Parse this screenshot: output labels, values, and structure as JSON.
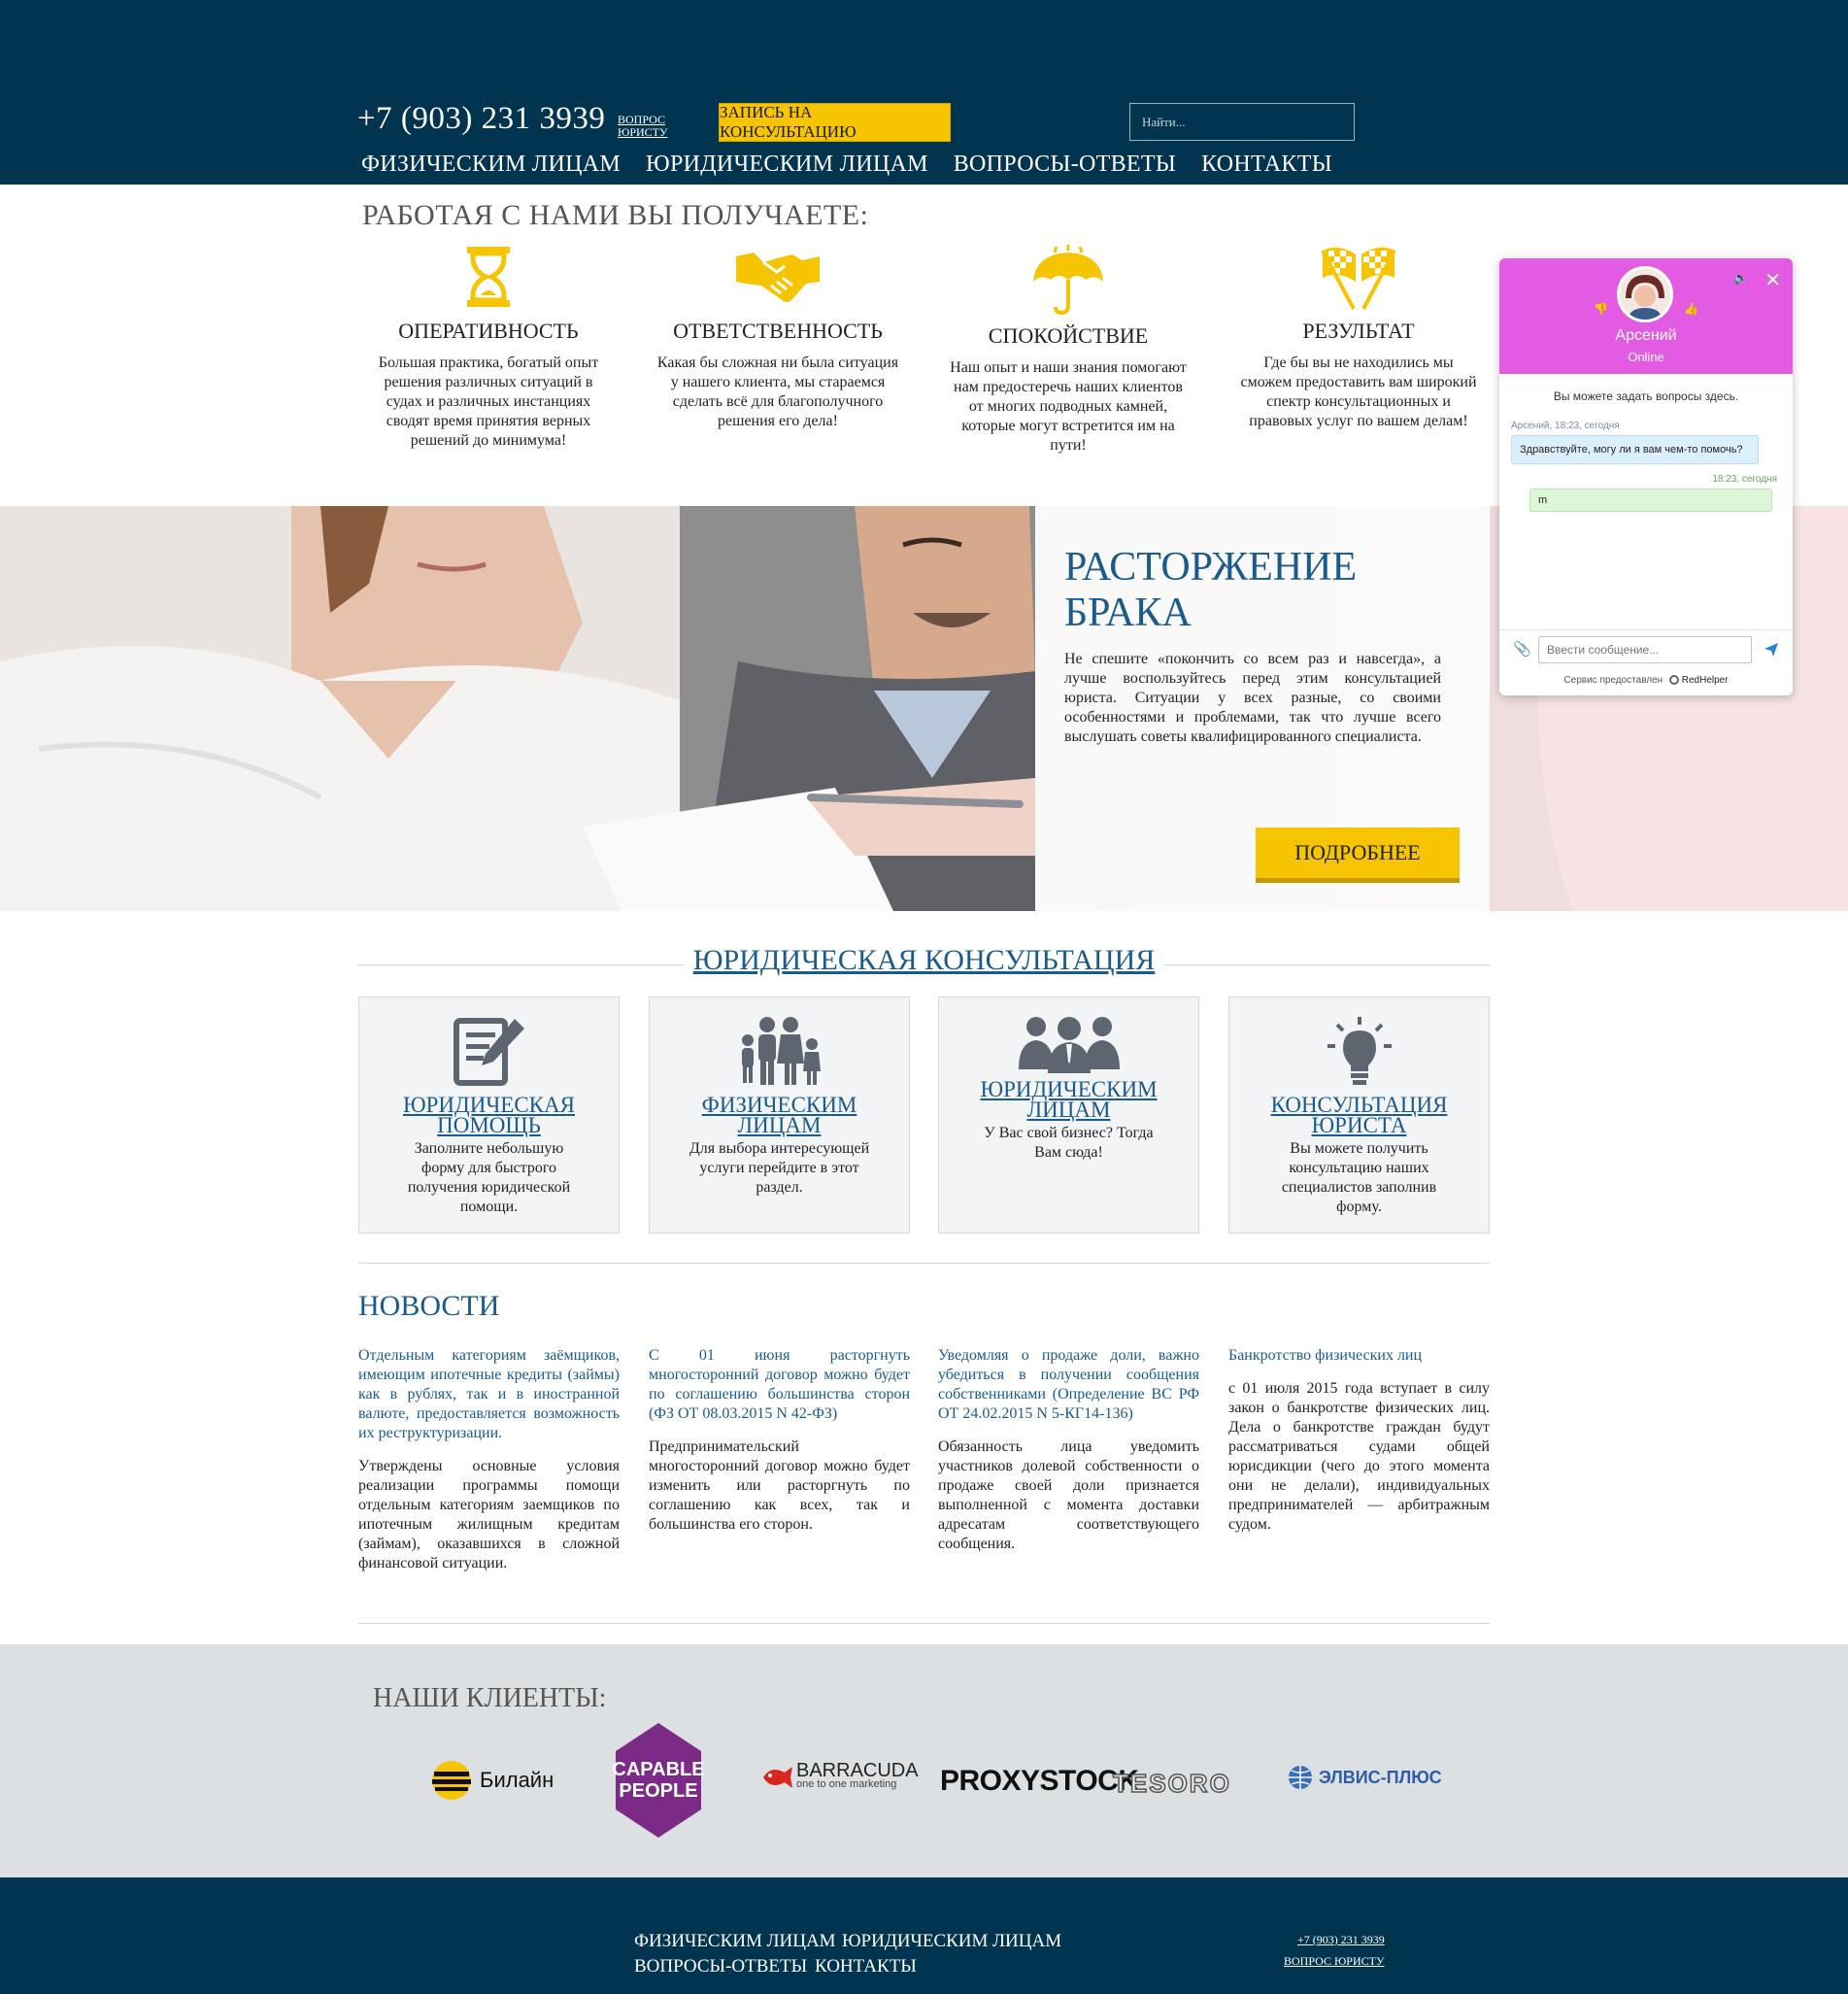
{
  "header": {
    "phone": "+7 (903) 231 3939",
    "ask_lawyer_line1": "ВОПРОС",
    "ask_lawyer_line2": "ЮРИСТУ",
    "consult_button": "ЗАПИСЬ НА КОНСУЛЬТАЦИЮ",
    "search_placeholder": "Найти...",
    "nav": [
      "ФИЗИЧЕСКИМ ЛИЦАМ",
      "ЮРИДИЧЕСКИМ ЛИЦАМ",
      "ВОПРОСЫ-ОТВЕТЫ",
      "КОНТАКТЫ"
    ]
  },
  "benefits": {
    "title": "РАБОТАЯ С НАМИ ВЫ ПОЛУЧАЕТЕ:",
    "items": [
      {
        "icon": "hourglass-icon",
        "title": "ОПЕРАТИВНОСТЬ",
        "text": "Большая практика, богатый опыт решения различных ситуаций в судах и различных инстанциях сводят время принятия верных решений до минимума!"
      },
      {
        "icon": "handshake-icon",
        "title": "ОТВЕТСТВЕННОСТЬ",
        "text": "Какая бы сложная ни была ситуация у нашего клиента, мы стараемся сделать всё для благополучного решения его дела!"
      },
      {
        "icon": "umbrella-icon",
        "title": "СПОКОЙСТВИЕ",
        "text": "Наш опыт и наши знания помогают нам предостеречь наших клиентов от многих подводных камней, которые могут встретится им на пути!"
      },
      {
        "icon": "checkered-flags-icon",
        "title": "РЕЗУЛЬТАТ",
        "text": "Где бы вы не находились мы сможем предоставить вам широкий спектр консультационных и правовых услуг по вашем делам!"
      }
    ]
  },
  "hero": {
    "title_line1": "РАСТОРЖЕНИЕ",
    "title_line2": "БРАКА",
    "text": "Не спешите «покончить со всем раз и навсегда», а лучше воспользуйтесь перед этим консультацией юриста. Ситуации у всех разные, со своими особенностями и проблемами, так что лучше всего выслушать советы квалифицированного специалиста.",
    "button": "ПОДРОБНЕЕ"
  },
  "consult": {
    "title": "ЮРИДИЧЕСКАЯ КОНСУЛЬТАЦИЯ",
    "cards": [
      {
        "icon": "document-pen-icon",
        "title": "ЮРИДИЧЕСКАЯ ПОМОЩЬ",
        "text": "Заполните небольшую форму для быстрого получения юридической помощи."
      },
      {
        "icon": "family-icon",
        "title": "ФИЗИЧЕСКИМ ЛИЦАМ",
        "text": "Для выбора интересующей услуги перейдите в этот раздел."
      },
      {
        "icon": "business-team-icon",
        "title": "ЮРИДИЧЕСКИМ ЛИЦАМ",
        "text": "У Вас свой бизнес? Тогда Вам сюда!"
      },
      {
        "icon": "lightbulb-icon",
        "title": "КОНСУЛЬТАЦИЯ ЮРИСТА",
        "text": "Вы можете получить консультацию наших специалистов заполнив форму."
      }
    ]
  },
  "news": {
    "title": "НОВОСТИ",
    "items": [
      {
        "headline": "Отдельным категориям заёмщиков, имеющим ипотечные кредиты (займы) как в рублях, так и в иностранной валюте, предоставляется возможность их реструктуризации.",
        "body": "Утверждены основные условия реализации программы помощи отдельным категориям заемщиков по ипотечным жилищным кредитам (займам), оказавшихся в сложной финансовой ситуации."
      },
      {
        "headline": "С 01 июня расторгнуть многосторонний договор можно будет по соглашению большинства сторон (ФЗ ОТ 08.03.2015 N 42-ФЗ)",
        "body": "Предпринимательский многосторонний договор можно будет изменить или расторгнуть по соглашению как всех, так и большинства его сторон."
      },
      {
        "headline": "Уведомляя о продаже доли, важно убедиться в получении сообщения собственниками (Определение ВС РФ ОТ 24.02.2015 N 5-КГ14-136)",
        "body": "Обязанность лица уведомить участников долевой собственности о продаже своей доли признается выполненной с момента доставки адресатам соответствующего сообщения."
      },
      {
        "headline": "Банкротство физических лиц",
        "body": "с 01 июля 2015 года вступает в силу закон о банкротстве физических лиц. Дела о банкротстве граждан будут рассматриваться судами общей юрисдикции (чего до этого момента они не делали), индивидуальных предпринимателей — арбитражным судом."
      }
    ]
  },
  "clients": {
    "title": "НАШИ КЛИЕНТЫ:",
    "logos": {
      "beeline": "Билайн",
      "capable_line1": "CAPABLE",
      "capable_line2": "PEOPLE",
      "barracuda": "BARRACUDA",
      "barracuda_sub": "one to one marketing",
      "proxystock": "PROXYSTOCK",
      "tesoro": "TESORO",
      "elvis": "ЭЛВИС-ПЛЮС"
    }
  },
  "footer": {
    "nav": [
      "ФИЗИЧЕСКИМ ЛИЦАМ",
      "ЮРИДИЧЕСКИМ ЛИЦАМ",
      "ВОПРОСЫ-ОТВЕТЫ",
      "КОНТАКТЫ"
    ],
    "phone": "+7 (903) 231 3939",
    "ask_lawyer": "ВОПРОС ЮРИСТУ"
  },
  "chat": {
    "agent_name": "Арсений",
    "status": "Online",
    "hint": "Вы можете задать вопросы здесь.",
    "agent_meta": "Арсений, 18:23, сегодня",
    "agent_message": "Здравствуйте, могу ли я вам чем-то помочь?",
    "user_meta": "18:23, сегодня",
    "user_message": "m",
    "input_placeholder": "Ввести сообщение...",
    "provided_by": "Сервис предоставлен",
    "provider": "RedHelper"
  },
  "colors": {
    "header_bg": "#00344f",
    "accent_yellow": "#f6c400",
    "link_blue": "#1a5a8c",
    "chat_header": "#e25be2",
    "clients_bg": "#dde0e2"
  }
}
